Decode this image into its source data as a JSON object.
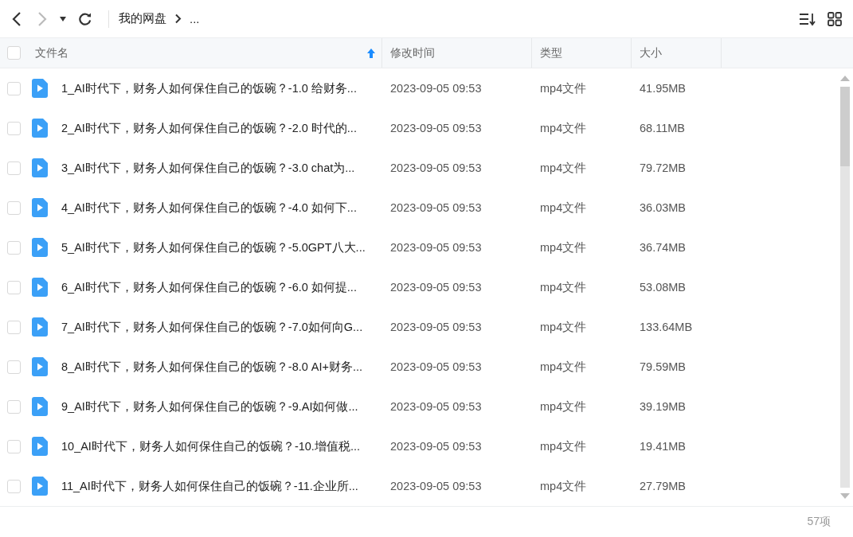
{
  "toolbar": {
    "nav": [
      {
        "kind": "back",
        "disabled": false
      },
      {
        "kind": "forward",
        "disabled": true
      },
      {
        "kind": "history",
        "disabled": false
      },
      {
        "kind": "refresh",
        "disabled": false
      }
    ],
    "breadcrumb": [
      "我的网盘",
      "..."
    ]
  },
  "table": {
    "all_checked": false,
    "columns": [
      {
        "label": "文件名",
        "sorted": true
      },
      {
        "label": "修改时间",
        "sorted": false
      },
      {
        "label": "类型",
        "sorted": false
      },
      {
        "label": "大小",
        "sorted": false
      }
    ],
    "rows": [
      {
        "checked": false,
        "name": "1_AI时代下，财务人如何保住自己的饭碗？-1.0 给财务...",
        "modified": "2023-09-05 09:53",
        "type": "mp4文件",
        "size": "41.95MB"
      },
      {
        "checked": false,
        "name": "2_AI时代下，财务人如何保住自己的饭碗？-2.0 时代的...",
        "modified": "2023-09-05 09:53",
        "type": "mp4文件",
        "size": "68.11MB"
      },
      {
        "checked": false,
        "name": "3_AI时代下，财务人如何保住自己的饭碗？-3.0 chat为...",
        "modified": "2023-09-05 09:53",
        "type": "mp4文件",
        "size": "79.72MB"
      },
      {
        "checked": false,
        "name": "4_AI时代下，财务人如何保住自己的饭碗？-4.0 如何下...",
        "modified": "2023-09-05 09:53",
        "type": "mp4文件",
        "size": "36.03MB"
      },
      {
        "checked": false,
        "name": "5_AI时代下，财务人如何保住自己的饭碗？-5.0GPT八大...",
        "modified": "2023-09-05 09:53",
        "type": "mp4文件",
        "size": "36.74MB"
      },
      {
        "checked": false,
        "name": "6_AI时代下，财务人如何保住自己的饭碗？-6.0 如何提...",
        "modified": "2023-09-05 09:53",
        "type": "mp4文件",
        "size": "53.08MB"
      },
      {
        "checked": false,
        "name": "7_AI时代下，财务人如何保住自己的饭碗？-7.0如何向G...",
        "modified": "2023-09-05 09:53",
        "type": "mp4文件",
        "size": "133.64MB"
      },
      {
        "checked": false,
        "name": "8_AI时代下，财务人如何保住自己的饭碗？-8.0 AI+财务...",
        "modified": "2023-09-05 09:53",
        "type": "mp4文件",
        "size": "79.59MB"
      },
      {
        "checked": false,
        "name": "9_AI时代下，财务人如何保住自己的饭碗？-9.AI如何做...",
        "modified": "2023-09-05 09:53",
        "type": "mp4文件",
        "size": "39.19MB"
      },
      {
        "checked": false,
        "name": "10_AI时代下，财务人如何保住自己的饭碗？-10.增值税...",
        "modified": "2023-09-05 09:53",
        "type": "mp4文件",
        "size": "19.41MB"
      },
      {
        "checked": false,
        "name": "11_AI时代下，财务人如何保住自己的饭碗？-11.企业所...",
        "modified": "2023-09-05 09:53",
        "type": "mp4文件",
        "size": "27.79MB"
      }
    ]
  },
  "status_bar": {
    "count": "57项"
  }
}
